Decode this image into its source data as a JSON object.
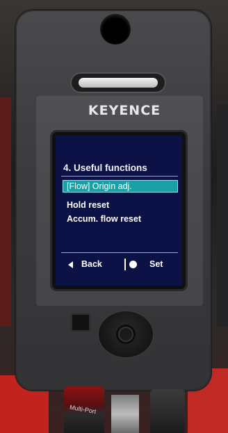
{
  "brand": "KEYENCE",
  "screen": {
    "title": "4. Useful functions",
    "menu_items": [
      {
        "label": "[Flow] Origin adj.",
        "selected": true
      },
      {
        "label": "Hold reset",
        "selected": false
      },
      {
        "label": "Accum. flow reset",
        "selected": false
      }
    ],
    "footer": {
      "back_label": "Back",
      "set_label": "Set"
    }
  },
  "connector_label": "Multi-Port",
  "colors": {
    "screen_background": "#0c1246",
    "selection_highlight": "#1a9fa6"
  },
  "icons": [
    "left-arrow-icon",
    "circle-button-icon"
  ]
}
